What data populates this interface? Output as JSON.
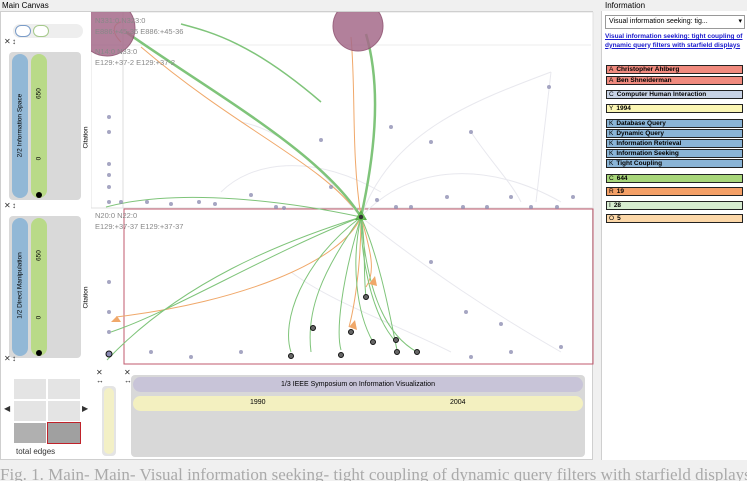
{
  "main_canvas": {
    "title": "Main Canvas"
  },
  "information": {
    "title": "Information",
    "dropdown_value": "Visual information seeking: tig...",
    "paper_link": "Visual information seeking: tight coupling of dynamic query filters with starfield displays",
    "items": [
      {
        "key": "A",
        "label": "Christopher Ahlberg",
        "color": "#f08a7e"
      },
      {
        "key": "A",
        "label": "Ben Shneiderman",
        "color": "#f08a7e"
      },
      {
        "key": "C",
        "label": "Computer Human Interaction",
        "color": "#c8d3e6"
      },
      {
        "key": "Y",
        "label": "1994",
        "color": "#fbf6b4"
      },
      {
        "key": "K",
        "label": "Database Query",
        "color": "#8ab4d6"
      },
      {
        "key": "K",
        "label": "Dynamic Query",
        "color": "#8ab4d6"
      },
      {
        "key": "K",
        "label": "Information Retrieval",
        "color": "#8ab4d6"
      },
      {
        "key": "K",
        "label": "Information Seeking",
        "color": "#8ab4d6"
      },
      {
        "key": "K",
        "label": "Tight Coupling",
        "color": "#8ab4d6"
      },
      {
        "key": "C",
        "label": "644",
        "color": "#a8d67a"
      },
      {
        "key": "R",
        "label": "19",
        "color": "#f4a067"
      },
      {
        "key": "I",
        "label": "28",
        "color": "#d6ecd0"
      },
      {
        "key": "O",
        "label": "5",
        "color": "#fcd7a8"
      }
    ]
  },
  "left_panels": {
    "top": {
      "label": "2/2 Information Space",
      "value_top": "650",
      "value_bottom": "0"
    },
    "bottom": {
      "label": "1/2 Direct Manipulation",
      "value_top": "650",
      "value_bottom": "0"
    }
  },
  "overlays": {
    "top_left_1": "N331:0  N323:0",
    "top_left_2": "E886:+45-36  E886:+45-36",
    "top_left_3": "N14:0  N33:0",
    "top_left_4": "E129:+37-2  E129:+37-2",
    "mid_left_1": "N20:0  N22:0",
    "mid_left_2": "E129:+37-37  E129:+37-37"
  },
  "axis_labels": {
    "upper": "Citation",
    "lower": "Citation"
  },
  "bottom_bar": {
    "venue": "1/3 IEEE Symposium on Information Visualization",
    "year_start": "1990",
    "year_end": "2004"
  },
  "minimap": {
    "label": "total edges"
  },
  "glyphs": {
    "close": "✕",
    "updown": "↕",
    "leftright": "↔",
    "arrow_left": "◀",
    "arrow_right": "▶"
  },
  "caption": "Fig. 1. Main- Main- Visual information seeking- tight coupling of dynamic query filters with starfield displays"
}
